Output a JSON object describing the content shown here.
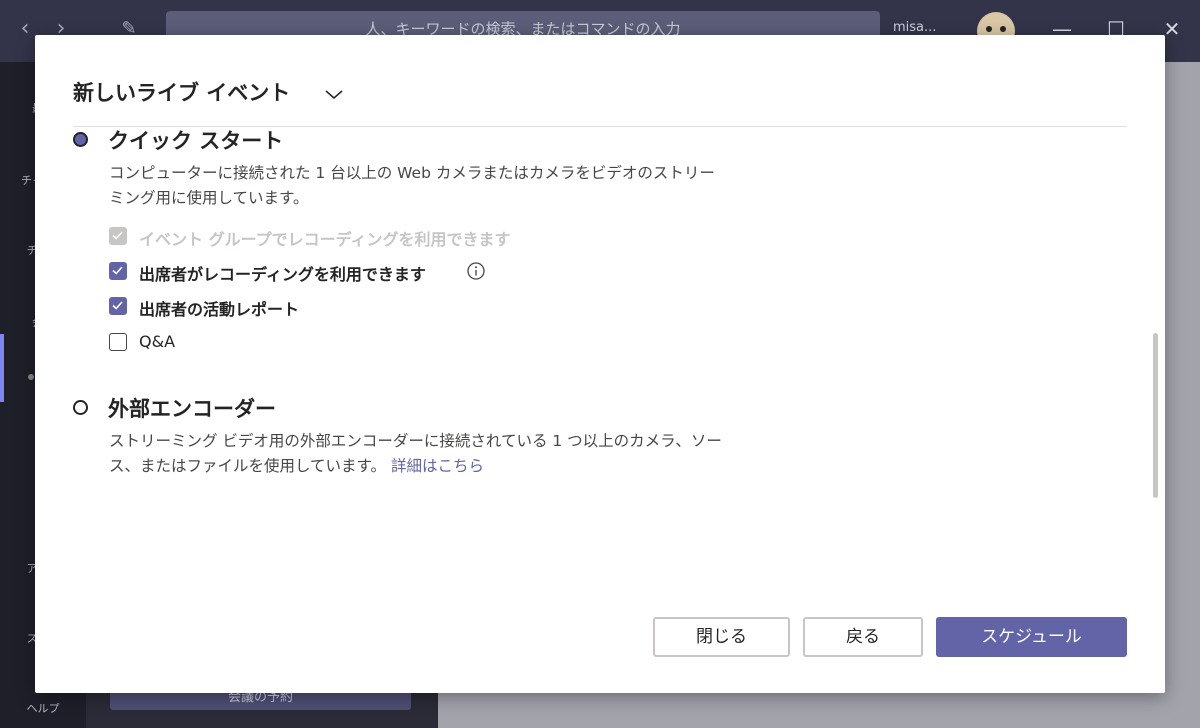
{
  "app": {
    "search_placeholder": "人、キーワードの検索、またはコマンドの入力",
    "user_name": "misa...",
    "rail": {
      "recent": "最新",
      "chat": "チャット",
      "teams": "チーム",
      "calendar": "会議",
      "apps": "アプリ",
      "help": "ヘルプ",
      "store": "ストア"
    },
    "bottom_button": "会議の予約"
  },
  "modal": {
    "title": "新しいライブ イベント",
    "options": [
      {
        "title": "クイック スタート",
        "selected": true,
        "description": "コンピューターに接続された 1 台以上の Web カメラまたはカメラをビデオのストリーミング用に使用しています。"
      },
      {
        "title": "外部エンコーダー",
        "selected": false,
        "description": "ストリーミング ビデオ用の外部エンコーダーに接続されている 1 つ以上のカメラ、ソース、またはファイルを使用しています。",
        "link": "詳細はこちら"
      }
    ],
    "checkboxes": [
      {
        "label": "イベント グループでレコーディングを利用できます",
        "checked": true,
        "disabled": true
      },
      {
        "label": "出席者がレコーディングを利用できます",
        "checked": true,
        "disabled": false
      },
      {
        "label": "出席者の活動レポート",
        "checked": true,
        "disabled": false
      },
      {
        "label": "Q&A",
        "checked": false,
        "disabled": false
      }
    ],
    "buttons": {
      "close": "閉じる",
      "back": "戻る",
      "schedule": "スケジュール"
    }
  },
  "colors": {
    "accent": "#6264a7",
    "title_bar": "#33344a",
    "disabled": "#c8c6c4"
  }
}
